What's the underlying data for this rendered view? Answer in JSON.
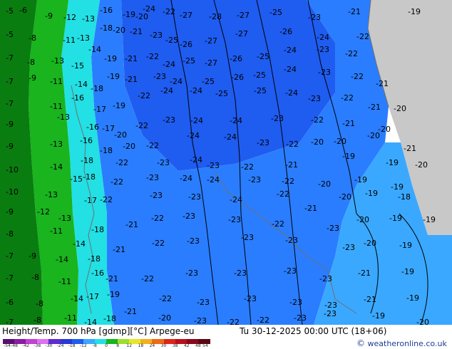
{
  "map": {
    "product": "Height/Temp. 700 hPa [gdmp][°C]",
    "model": "Arpege-eu",
    "valid_time": "Tu 30-12-2025 00:00 UTC (18+06)",
    "zones": [
      {
        "name": "land-coast",
        "color": "#c8c8c8"
      },
      {
        "name": "temp-band-dark-green",
        "color": "#0a7d10"
      },
      {
        "name": "temp-band-green",
        "color": "#19b41e"
      },
      {
        "name": "temp-band-cyan",
        "color": "#22e0e4"
      },
      {
        "name": "temp-band-light-blue",
        "color": "#3aa8ff"
      },
      {
        "name": "temp-band-mid-blue",
        "color": "#2a7dff"
      },
      {
        "name": "temp-band-deep-blue",
        "color": "#1f5cf0"
      }
    ],
    "labels": [
      [
        "-5",
        8,
        9
      ],
      [
        "-6",
        27,
        8
      ],
      [
        "-9",
        63,
        16
      ],
      [
        "-12",
        89,
        18
      ],
      [
        "-13",
        115,
        20
      ],
      [
        "-16",
        140,
        8
      ],
      [
        "-19",
        172,
        14
      ],
      [
        "-20",
        190,
        17
      ],
      [
        "-24",
        200,
        6
      ],
      [
        "-22",
        228,
        10
      ],
      [
        "-27",
        252,
        15
      ],
      [
        "-28",
        293,
        17
      ],
      [
        "-27",
        332,
        15
      ],
      [
        "-25",
        378,
        11
      ],
      [
        "-23",
        432,
        18
      ],
      [
        "-21",
        488,
        10
      ],
      [
        "-19",
        572,
        10
      ],
      [
        "-5",
        8,
        42
      ],
      [
        "-8",
        40,
        47
      ],
      [
        "-11",
        88,
        50
      ],
      [
        "-13",
        108,
        47
      ],
      [
        "-14",
        124,
        63
      ],
      [
        "-18",
        140,
        33
      ],
      [
        "-20",
        158,
        36
      ],
      [
        "-21",
        182,
        38
      ],
      [
        "-23",
        210,
        43
      ],
      [
        "-25",
        232,
        50
      ],
      [
        "-26",
        252,
        56
      ],
      [
        "-27",
        287,
        51
      ],
      [
        "-27",
        330,
        41
      ],
      [
        "-26",
        392,
        38
      ],
      [
        "-24",
        444,
        46
      ],
      [
        "-22",
        500,
        45
      ],
      [
        "-7",
        8,
        75
      ],
      [
        "-8",
        38,
        81
      ],
      [
        "-13",
        72,
        79
      ],
      [
        "-15",
        100,
        86
      ],
      [
        "-19",
        146,
        76
      ],
      [
        "-21",
        175,
        76
      ],
      [
        "-22",
        205,
        73
      ],
      [
        "-24",
        228,
        84
      ],
      [
        "-25",
        256,
        79
      ],
      [
        "-27",
        287,
        82
      ],
      [
        "-26",
        322,
        76
      ],
      [
        "-25",
        360,
        73
      ],
      [
        "-24",
        398,
        64
      ],
      [
        "-23",
        444,
        63
      ],
      [
        "-22",
        484,
        69
      ],
      [
        "-7",
        8,
        108
      ],
      [
        "-9",
        40,
        103
      ],
      [
        "-11",
        70,
        108
      ],
      [
        "-14",
        105,
        112
      ],
      [
        "-18",
        127,
        118
      ],
      [
        "-19",
        150,
        101
      ],
      [
        "-21",
        175,
        105
      ],
      [
        "-23",
        215,
        101
      ],
      [
        "-24",
        238,
        108
      ],
      [
        "-25",
        283,
        108
      ],
      [
        "-26",
        324,
        102
      ],
      [
        "-25",
        355,
        99
      ],
      [
        "-24",
        398,
        91
      ],
      [
        "-23",
        446,
        95
      ],
      [
        "-22",
        492,
        101
      ],
      [
        "-21",
        527,
        111
      ],
      [
        "-7",
        8,
        139
      ],
      [
        "-11",
        70,
        143
      ],
      [
        "-16",
        100,
        131
      ],
      [
        "-17",
        131,
        147
      ],
      [
        "-19",
        158,
        142
      ],
      [
        "-22",
        193,
        128
      ],
      [
        "-24",
        225,
        121
      ],
      [
        "-24",
        266,
        121
      ],
      [
        "-25",
        302,
        125
      ],
      [
        "-25",
        356,
        121
      ],
      [
        "-24",
        400,
        124
      ],
      [
        "-23",
        432,
        132
      ],
      [
        "-22",
        478,
        131
      ],
      [
        "-21",
        516,
        144
      ],
      [
        "-20",
        552,
        146
      ],
      [
        "-9",
        8,
        168
      ],
      [
        "-13",
        80,
        158
      ],
      [
        "-16",
        121,
        172
      ],
      [
        "-17",
        143,
        174
      ],
      [
        "-20",
        160,
        183
      ],
      [
        "-22",
        190,
        170
      ],
      [
        "-23",
        228,
        162
      ],
      [
        "-24",
        267,
        163
      ],
      [
        "-24",
        322,
        163
      ],
      [
        "-23",
        380,
        160
      ],
      [
        "-22",
        436,
        162
      ],
      [
        "-21",
        480,
        167
      ],
      [
        "-20",
        530,
        175
      ],
      [
        "-9",
        8,
        199
      ],
      [
        "-13",
        70,
        196
      ],
      [
        "-16",
        112,
        191
      ],
      [
        "-18",
        140,
        205
      ],
      [
        "-20",
        172,
        199
      ],
      [
        "-22",
        205,
        198
      ],
      [
        "-24",
        262,
        184
      ],
      [
        "-24",
        314,
        186
      ],
      [
        "-23",
        360,
        194
      ],
      [
        "-22",
        401,
        196
      ],
      [
        "-20",
        436,
        193
      ],
      [
        "-20",
        468,
        192
      ],
      [
        "-20",
        515,
        184
      ],
      [
        "-21",
        566,
        202
      ],
      [
        "-10",
        8,
        232
      ],
      [
        "-14",
        70,
        228
      ],
      [
        "-18",
        113,
        219
      ],
      [
        "-22",
        162,
        222
      ],
      [
        "-23",
        220,
        222
      ],
      [
        "-24",
        266,
        218
      ],
      [
        "-23",
        290,
        226
      ],
      [
        "-22",
        338,
        228
      ],
      [
        "-21",
        400,
        225
      ],
      [
        "-19",
        480,
        213
      ],
      [
        "-19",
        541,
        222
      ],
      [
        "-20",
        582,
        225
      ],
      [
        "-10",
        8,
        263
      ],
      [
        "-13",
        63,
        267
      ],
      [
        "-15",
        98,
        245
      ],
      [
        "-18",
        116,
        242
      ],
      [
        "-22",
        155,
        249
      ],
      [
        "-23",
        205,
        243
      ],
      [
        "-24",
        252,
        244
      ],
      [
        "-24",
        290,
        246
      ],
      [
        "-23",
        348,
        246
      ],
      [
        "-22",
        395,
        248
      ],
      [
        "-20",
        446,
        252
      ],
      [
        "-19",
        497,
        246
      ],
      [
        "-19",
        548,
        256
      ],
      [
        "-9",
        8,
        291
      ],
      [
        "-12",
        52,
        291
      ],
      [
        "-13",
        82,
        300
      ],
      [
        "-17",
        118,
        275
      ],
      [
        "-22",
        140,
        274
      ],
      [
        "-23",
        210,
        268
      ],
      [
        "-23",
        264,
        270
      ],
      [
        "-24",
        322,
        274
      ],
      [
        "-22",
        388,
        266
      ],
      [
        "-21",
        427,
        286
      ],
      [
        "-20",
        475,
        270
      ],
      [
        "-19",
        512,
        265
      ],
      [
        "-18",
        558,
        270
      ],
      [
        "-8",
        8,
        322
      ],
      [
        "-11",
        70,
        318
      ],
      [
        "-14",
        102,
        336
      ],
      [
        "-18",
        128,
        316
      ],
      [
        "-21",
        176,
        309
      ],
      [
        "-22",
        212,
        300
      ],
      [
        "-23",
        256,
        297
      ],
      [
        "-23",
        320,
        302
      ],
      [
        "-22",
        381,
        308
      ],
      [
        "-23",
        458,
        314
      ],
      [
        "-20",
        500,
        302
      ],
      [
        "-19",
        546,
        300
      ],
      [
        "-19",
        593,
        302
      ],
      [
        "-7",
        8,
        353
      ],
      [
        "-9",
        40,
        353
      ],
      [
        "-14",
        78,
        358
      ],
      [
        "-18",
        123,
        357
      ],
      [
        "-21",
        158,
        344
      ],
      [
        "-22",
        213,
        335
      ],
      [
        "-23",
        262,
        332
      ],
      [
        "-23",
        338,
        327
      ],
      [
        "-23",
        400,
        331
      ],
      [
        "-23",
        480,
        341
      ],
      [
        "-20",
        510,
        335
      ],
      [
        "-19",
        560,
        338
      ],
      [
        "-7",
        8,
        384
      ],
      [
        "-8",
        44,
        383
      ],
      [
        "-11",
        82,
        389
      ],
      [
        "-16",
        128,
        377
      ],
      [
        "-21",
        148,
        385
      ],
      [
        "-22",
        198,
        385
      ],
      [
        "-23",
        260,
        377
      ],
      [
        "-23",
        328,
        377
      ],
      [
        "-23",
        398,
        374
      ],
      [
        "-23",
        448,
        385
      ],
      [
        "-21",
        502,
        377
      ],
      [
        "-19",
        563,
        375
      ],
      [
        "-6",
        8,
        418
      ],
      [
        "-8",
        50,
        420
      ],
      [
        "-14",
        99,
        413
      ],
      [
        "-17",
        121,
        410
      ],
      [
        "-19",
        150,
        407
      ],
      [
        "-21",
        174,
        431
      ],
      [
        "-22",
        223,
        413
      ],
      [
        "-23",
        276,
        418
      ],
      [
        "-23",
        342,
        413
      ],
      [
        "-23",
        406,
        418
      ],
      [
        "-23",
        455,
        422
      ],
      [
        "-21",
        510,
        414
      ],
      [
        "-19",
        570,
        412
      ],
      [
        "-7",
        8,
        446
      ],
      [
        "-8",
        47,
        443
      ],
      [
        "-11",
        90,
        440
      ],
      [
        "-14",
        118,
        446
      ],
      [
        "-18",
        145,
        441
      ],
      [
        "-20",
        222,
        440
      ],
      [
        "-23",
        272,
        444
      ],
      [
        "-22",
        318,
        446
      ],
      [
        "-22",
        360,
        443
      ],
      [
        "-23",
        412,
        440
      ],
      [
        "-23",
        454,
        434
      ],
      [
        "-19",
        522,
        437
      ],
      [
        "-20",
        584,
        446
      ]
    ]
  },
  "legend": {
    "ticks": [
      "-54",
      "-48",
      "-42",
      "-38",
      "-30",
      "-24",
      "-18",
      "-12",
      "-8",
      "0",
      "8",
      "12",
      "18",
      "24",
      "30",
      "38",
      "42",
      "48",
      "54"
    ],
    "colors": [
      "#5a0d73",
      "#8c1aa3",
      "#c43fd6",
      "#e06ff5",
      "#5e2bd1",
      "#2838d9",
      "#1f5cf0",
      "#3aa8ff",
      "#22e0e4",
      "#19b41e",
      "#9be02a",
      "#e6e62a",
      "#f2b01e",
      "#ef6b12",
      "#e0241b",
      "#b8101a",
      "#87081a",
      "#5c0613"
    ]
  },
  "credit": {
    "symbol": "©",
    "text": "weatheronline.co.uk"
  }
}
